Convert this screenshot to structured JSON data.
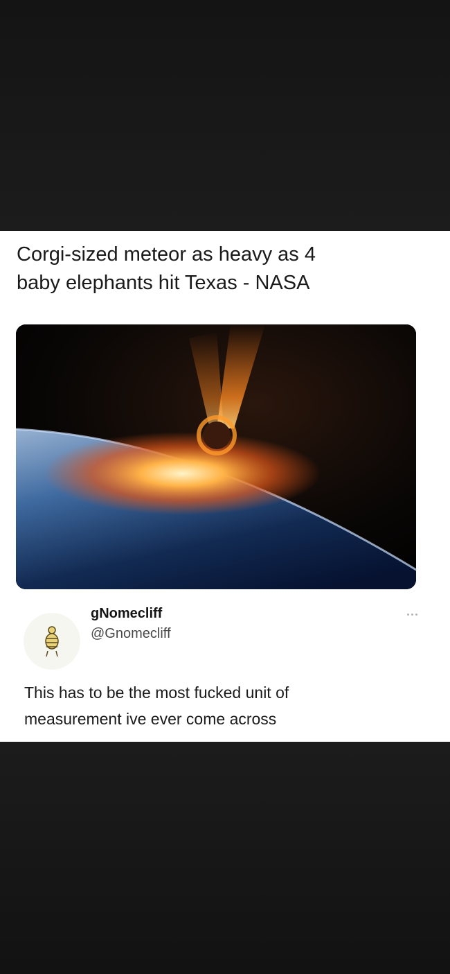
{
  "post": {
    "headline_line1": "Corgi-sized meteor as heavy as 4",
    "headline_line2": "baby elephants hit Texas - NASA",
    "image": "meteor-hitting-earth-illustration"
  },
  "tweet": {
    "display_name": "gNomecliff",
    "handle": "@Gnomecliff",
    "text_line1": "This has to be the most fucked unit of",
    "text_line2": "measurement ive ever come across",
    "more_icon": "more-options-icon"
  },
  "colors": {
    "page_background": "#141414",
    "card_background": "#ffffff",
    "text": "#1a1a1a",
    "handle_text": "#4a4a4a"
  }
}
